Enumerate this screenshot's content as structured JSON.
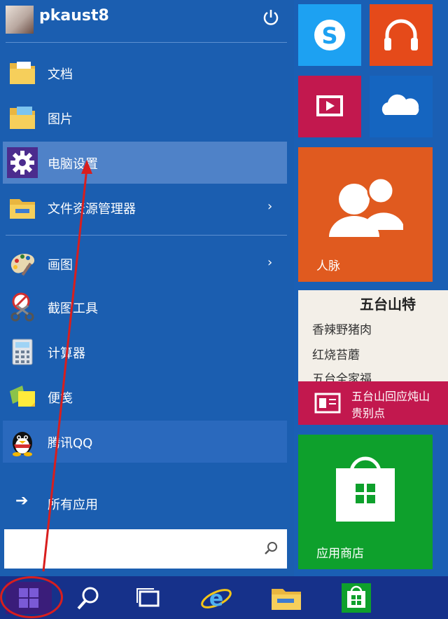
{
  "user": {
    "name": "pkaust8"
  },
  "menu_items": [
    {
      "label": "文档"
    },
    {
      "label": "图片"
    },
    {
      "label": "电脑设置"
    },
    {
      "label": "文件资源管理器",
      "arrow": "›"
    },
    {
      "label": "画图",
      "arrow": "›"
    },
    {
      "label": "截图工具"
    },
    {
      "label": "计算器"
    },
    {
      "label": "便笺"
    },
    {
      "label": "腾讯QQ"
    }
  ],
  "all_apps": {
    "label": "所有应用",
    "arrow": "➔"
  },
  "search": {
    "value": "",
    "placeholder": ""
  },
  "tiles": {
    "people": {
      "label": "人脉",
      "color": "#e05a1f"
    },
    "news": {
      "headline": "五台山特",
      "menu_lines": [
        "香辣野猪肉",
        "红烧苔蘑",
        "五台全家福"
      ],
      "caption_line1": "五台山回应炖山",
      "caption_line2": "贵别点",
      "caption_color": "#c2184e"
    },
    "store": {
      "label": "应用商店",
      "color": "#0ea02c"
    }
  },
  "colors": {
    "skype": "#1da1f2",
    "music": "#e54a1a",
    "video": "#c2184e",
    "onedrive": "#1565c0"
  },
  "icons": [
    "power-icon",
    "documents-folder-icon",
    "pictures-folder-icon",
    "gear-icon",
    "file-explorer-icon",
    "paint-icon",
    "snipping-tool-icon",
    "calculator-icon",
    "sticky-notes-icon",
    "qq-penguin-icon",
    "skype-icon",
    "headphones-icon",
    "video-icon",
    "onedrive-cloud-icon",
    "people-icon",
    "store-bag-icon",
    "windows-logo-icon",
    "search-icon",
    "task-view-icon",
    "internet-explorer-icon",
    "folder-icon",
    "store-icon"
  ]
}
